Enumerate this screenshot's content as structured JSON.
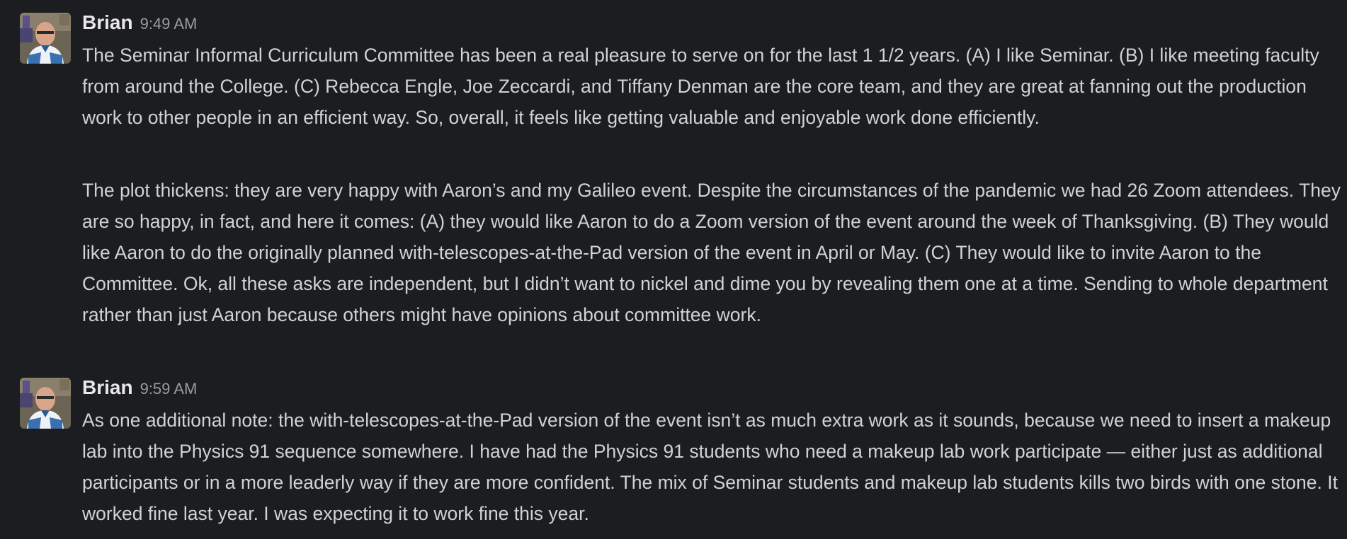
{
  "messages": [
    {
      "author": "Brian",
      "time": "9:49 AM",
      "paragraphs": [
        "The Seminar Informal Curriculum Committee has been a real pleasure to serve on for the last 1 1/2 years. (A) I like Seminar. (B) I like meeting faculty from around the College. (C) Rebecca Engle, Joe Zeccardi, and Tiffany Denman are the core team, and they are great at fanning out the production work to other people in an efficient way. So, overall, it feels like getting valuable and enjoyable work done efficiently.",
        "The plot thickens: they are very happy with Aaron’s and my Galileo event. Despite the circumstances of the pandemic we had 26 Zoom attendees. They are so happy, in fact, and here it comes: (A) they would like Aaron to do a Zoom version of the event around the week of  Thanksgiving. (B) They would like Aaron to do the originally planned with-telescopes-at-the-Pad version of the event in April or May. (C) They would like to invite Aaron to the Committee. Ok, all these asks are independent, but I didn’t want to nickel and dime you by revealing them one at a time. Sending to whole department rather than just Aaron because others might have opinions about committee work."
      ]
    },
    {
      "author": "Brian",
      "time": "9:59 AM",
      "paragraphs": [
        "As one additional note: the with-telescopes-at-the-Pad version of the event isn’t as much extra work as it sounds, because we need to insert a makeup lab into the Physics 91 sequence somewhere. I have had the Physics 91 students who need a makeup lab work participate — either just as additional participants or in a more leaderly way if they are more confident. The mix of Seminar students and makeup lab students kills two birds with one stone. It worked fine last year. I was expecting it to work fine this year."
      ]
    }
  ],
  "colors": {
    "background": "#1b1d21",
    "text": "#d1d2d3",
    "author": "#e8e8e8",
    "timestamp": "#9a9b9d"
  },
  "icons": {
    "avatar": "user-avatar-photo"
  }
}
